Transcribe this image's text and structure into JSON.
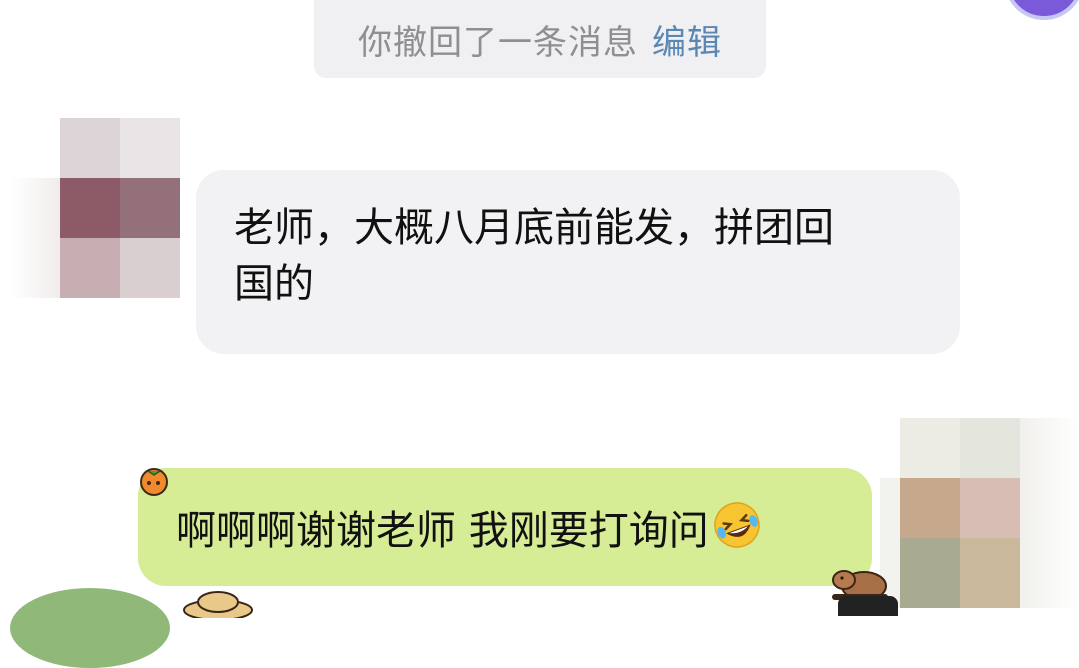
{
  "system_notice": {
    "text": "你撤回了一条消息",
    "action": "编辑"
  },
  "messages": [
    {
      "direction": "incoming",
      "lines": [
        "老师，大概八月底前能发，拼团回",
        "国的"
      ]
    },
    {
      "direction": "outgoing",
      "text": "啊啊啊谢谢老师 我刚要打询问",
      "emoji": "rolling-on-floor-laughing"
    }
  ],
  "colors": {
    "incoming_bubble": "#f2f2f4",
    "outgoing_bubble": "#d6ec95",
    "edit_link": "#5b87b5",
    "notice_text": "#8e8e93"
  }
}
